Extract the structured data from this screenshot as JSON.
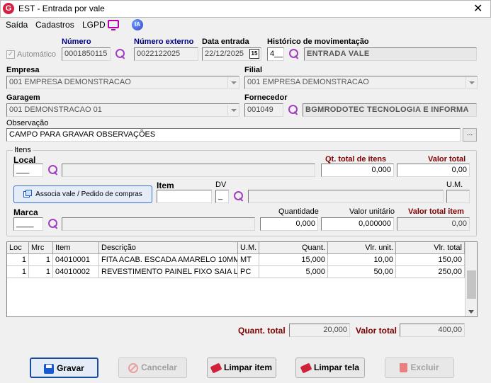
{
  "window": {
    "title": "EST - Entrada por vale",
    "logo_letter": "G",
    "close": "✕"
  },
  "menu": {
    "items": [
      "Saída",
      "Cadastros",
      "LGPD"
    ],
    "ia_label": "IA"
  },
  "header": {
    "automatico_label": "Automático",
    "numero_label": "Número",
    "numero_value": "0001850115",
    "numero_externo_label": "Número externo",
    "numero_externo_value": "0022122025",
    "data_entrada_label": "Data entrada",
    "data_entrada_value": "22/12/2025",
    "calendar_glyph": "15",
    "historico_label": "Histórico de movimentação",
    "historico_code": "4__",
    "historico_desc": "ENTRADA VALE",
    "empresa_label": "Empresa",
    "empresa_value": "001 EMPRESA DEMONSTRACAO",
    "filial_label": "Filial",
    "filial_value": "001 EMPRESA DEMONSTRACAO",
    "garagem_label": "Garagem",
    "garagem_value": "001 DEMONSTRACAO 01",
    "fornecedor_label": "Fornecedor",
    "fornecedor_code": "001049",
    "fornecedor_desc": "BGMRODOTEC TECNOLOGIA E INFORMA",
    "observacao_label": "Observação",
    "observacao_value": "CAMPO PARA GRAVAR OBSERVAÇÕES",
    "observacao_btn": "..."
  },
  "itens": {
    "group_label": "Itens",
    "local_label": "Local",
    "local_value": "___",
    "qt_total_label": "Qt. total de itens",
    "qt_total_value": "0,000",
    "valor_total_label": "Valor total",
    "valor_total_value": "0,00",
    "associa_btn": "Associa vale / Pedido de compras",
    "item_label": "Item",
    "dv_label": "DV",
    "dv_value": "_",
    "um_label": "U.M.",
    "marca_label": "Marca",
    "marca_value": "____",
    "quantidade_label": "Quantidade",
    "quantidade_value": "0,000",
    "valor_unitario_label": "Valor unitário",
    "valor_unitario_value": "0,000000",
    "valor_total_item_label": "Valor total item",
    "valor_total_item_value": "0,00"
  },
  "grid": {
    "columns": [
      "Loc",
      "Mrc",
      "Item",
      "Descrição",
      "U.M.",
      "Quant.",
      "Vlr. unit.",
      "Vlr. total"
    ],
    "rows": [
      [
        "1",
        "1",
        "04010001",
        "FITA ACAB. ESCADA AMARELO 10MM",
        "MT",
        "15,000",
        "10,00",
        "150,00"
      ],
      [
        "1",
        "1",
        "04010002",
        "REVESTIMENTO PAINEL FIXO SAIA LI",
        "PC",
        "5,000",
        "50,00",
        "250,00"
      ]
    ]
  },
  "totals": {
    "quant_label": "Quant. total",
    "quant_value": "20,000",
    "valor_label": "Valor total",
    "valor_value": "400,00"
  },
  "buttons": {
    "gravar": "Gravar",
    "cancelar": "Cancelar",
    "limpar_item": "Limpar item",
    "limpar_tela": "Limpar tela",
    "excluir": "Excluir"
  },
  "colors": {
    "accent_blue": "#00007f",
    "accent_red": "#7f0000",
    "logo": "#d4213d",
    "lgpd": "#b400b4",
    "search": "#a040c0"
  }
}
